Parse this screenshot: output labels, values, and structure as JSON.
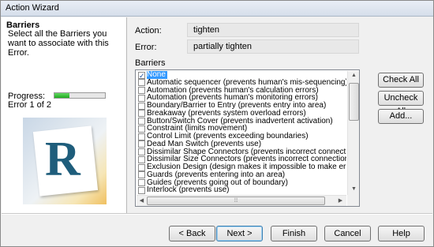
{
  "window": {
    "title": "Action Wizard"
  },
  "left_panel": {
    "heading": "Barriers",
    "description": "Select all the Barriers you want to associate with this Error.",
    "progress_label": "Progress:",
    "progress_fraction": 0.3,
    "progress_color": "#2db52d",
    "error_count": "Error 1 of 2",
    "logo_letter": "R"
  },
  "fields": {
    "action_label": "Action:",
    "action_value": "tighten",
    "error_label": "Error:",
    "error_value": "partially tighten"
  },
  "barriers": {
    "label": "Barriers",
    "items": [
      {
        "text": "None",
        "checked": true,
        "selected": true
      },
      {
        "text": "Automatic sequencer (prevents human's mis-sequencing)",
        "checked": false
      },
      {
        "text": "Automation (prevents human's calculation errors)",
        "checked": false
      },
      {
        "text": "Automation (prevents human's monitoring errors)",
        "checked": false
      },
      {
        "text": "Boundary/Barrier to Entry (prevents entry into area)",
        "checked": false
      },
      {
        "text": "Breakaway (prevents system overload errors)",
        "checked": false
      },
      {
        "text": "Button/Switch Cover (prevents inadvertent activation)",
        "checked": false
      },
      {
        "text": "Constraint (limits movement)",
        "checked": false
      },
      {
        "text": "Control Limit (prevents exceeding boundaries)",
        "checked": false
      },
      {
        "text": "Dead Man Switch (prevents use)",
        "checked": false
      },
      {
        "text": "Dissimilar Shape Connectors (prevents incorrect connection)",
        "checked": false
      },
      {
        "text": "Dissimilar Size Connectors (prevents incorrect connection)",
        "checked": false
      },
      {
        "text": "Exclusion Design (design makes it impossible to make error)",
        "checked": false
      },
      {
        "text": "Guards (prevents entering into an area)",
        "checked": false
      },
      {
        "text": "Guides (prevents going out of boundary)",
        "checked": false
      },
      {
        "text": "Interlock (prevents use)",
        "checked": false
      }
    ]
  },
  "side_buttons": {
    "check_all": "Check All",
    "uncheck_all": "Uncheck All",
    "add": "Add..."
  },
  "bottom_buttons": {
    "back": "< Back",
    "next": "Next >",
    "finish": "Finish",
    "cancel": "Cancel",
    "help": "Help"
  },
  "icons": {
    "checkmark": "check-icon",
    "scroll_up": "chevron-up-icon",
    "scroll_down": "chevron-down-icon",
    "scroll_left": "chevron-left-icon",
    "scroll_right": "chevron-right-icon",
    "scroll_grip": "grip-icon"
  }
}
